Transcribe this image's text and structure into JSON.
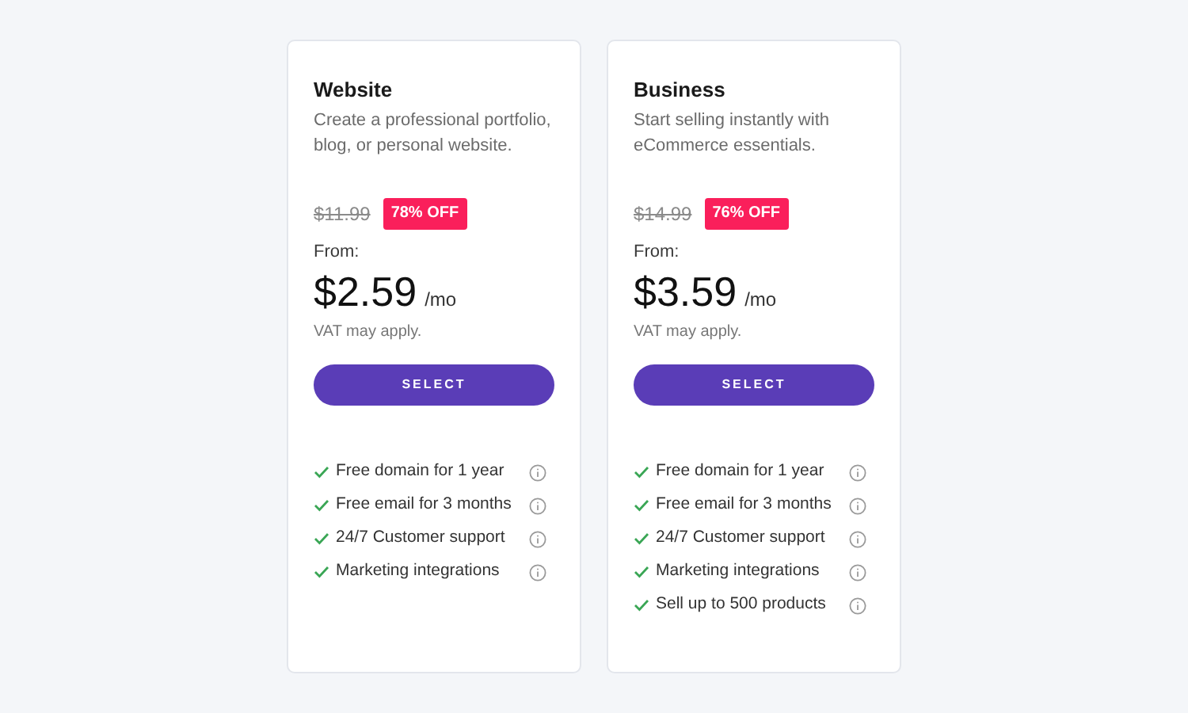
{
  "plans": [
    {
      "name": "Website",
      "description": "Create a professional portfolio, blog, or personal website.",
      "old_price": "$11.99",
      "discount": "78% OFF",
      "from_label": "From:",
      "price": "$2.59",
      "period": "/mo",
      "vat_note": "VAT may apply.",
      "button": "SELECT",
      "features": [
        "Free domain for 1 year",
        "Free email for 3 months",
        "24/7 Customer support",
        "Marketing integrations"
      ]
    },
    {
      "name": "Business",
      "description": "Start selling instantly with eCommerce essentials.",
      "old_price": "$14.99",
      "discount": "76% OFF",
      "from_label": "From:",
      "price": "$3.59",
      "period": "/mo",
      "vat_note": "VAT may apply.",
      "button": "SELECT",
      "features": [
        "Free domain for 1 year",
        "Free email for 3 months",
        "24/7 Customer support",
        "Marketing integrations",
        "Sell up to 500 products"
      ]
    }
  ]
}
